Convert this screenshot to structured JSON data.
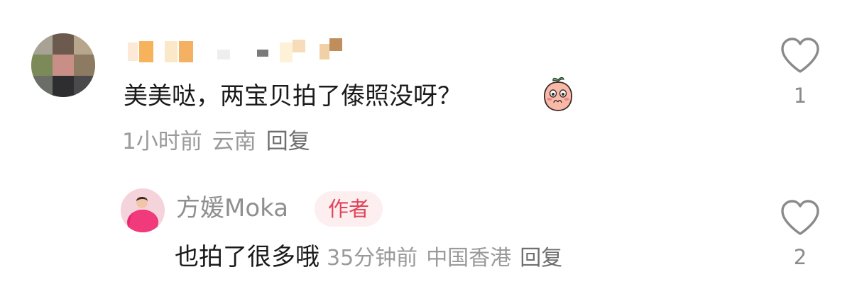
{
  "comment": {
    "text": "美美哒，两宝贝拍了傣照没呀？",
    "emoji_icon": "shy-peach-emoji-icon",
    "time": "1小时前",
    "location": "云南",
    "reply_label": "回复",
    "like_count": "1"
  },
  "reply": {
    "author_name": "方媛Moka",
    "author_badge": "作者",
    "text": "也拍了很多哦",
    "time": "35分钟前",
    "location": "中国香港",
    "reply_label": "回复",
    "like_count": "2"
  },
  "colors": {
    "text_primary": "#1a1a1a",
    "text_meta": "#9a9a9a",
    "badge_bg": "#fdeef0",
    "badge_text": "#e0455b",
    "like_icon_stroke": "#8a8a8a"
  }
}
